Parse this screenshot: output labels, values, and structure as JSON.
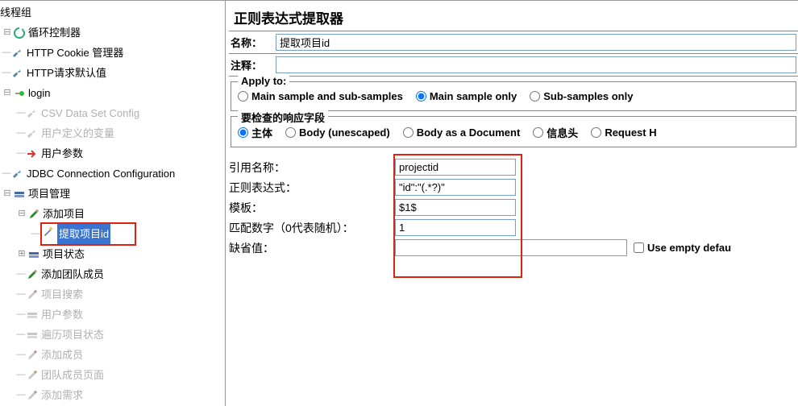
{
  "tree": {
    "root": "线程组",
    "items": [
      {
        "label": "循环控制器",
        "icon": "loop",
        "indent": 1,
        "toggle": "minus"
      },
      {
        "label": "HTTP Cookie 管理器",
        "icon": "wrench",
        "indent": 1,
        "dash": true
      },
      {
        "label": "HTTP请求默认值",
        "icon": "wrench",
        "indent": 1,
        "dash": true
      },
      {
        "label": "login",
        "icon": "dot-green",
        "indent": 1,
        "toggle": "minus"
      },
      {
        "label": "CSV Data Set Config",
        "icon": "wrench",
        "indent": 2,
        "dim": true,
        "dash": true
      },
      {
        "label": "用户定义的变量",
        "icon": "wrench",
        "indent": 2,
        "dim": true,
        "dash": true
      },
      {
        "label": "用户参数",
        "icon": "arrow-red",
        "indent": 2,
        "dash": true
      },
      {
        "label": "JDBC Connection Configuration",
        "icon": "wrench",
        "indent": 1,
        "dash": true
      },
      {
        "label": "项目管理",
        "icon": "stack",
        "indent": 1,
        "toggle": "minus"
      },
      {
        "label": "添加项目",
        "icon": "pencil",
        "indent": 2,
        "toggle": "minus"
      },
      {
        "label": "提取项目id",
        "icon": "wand",
        "indent": 3,
        "selected": true,
        "dash": true,
        "boxed": true
      },
      {
        "label": "项目状态",
        "icon": "stack",
        "indent": 2,
        "toggle": "plus"
      },
      {
        "label": "添加团队成员",
        "icon": "pencil",
        "indent": 2,
        "dash": true
      },
      {
        "label": "项目搜索",
        "icon": "pencil",
        "indent": 2,
        "dim": true,
        "dash": true
      },
      {
        "label": "用户参数",
        "icon": "stack",
        "indent": 2,
        "dim": true,
        "dash": true
      },
      {
        "label": "遍历项目状态",
        "icon": "stack",
        "indent": 2,
        "dim": true,
        "dash": true
      },
      {
        "label": "添加成员",
        "icon": "pencil",
        "indent": 2,
        "dim": true,
        "dash": true
      },
      {
        "label": "团队成员页面",
        "icon": "pencil",
        "indent": 2,
        "dim": true,
        "dash": true
      },
      {
        "label": "添加需求",
        "icon": "pencil",
        "indent": 2,
        "dim": true,
        "dash": true
      }
    ]
  },
  "panel": {
    "title": "正则表达式提取器",
    "name_label": "名称：",
    "name_value": "提取项目id",
    "comment_label": "注释：",
    "comment_value": "",
    "apply_group": "Apply to:",
    "apply_options": [
      "Main sample and sub-samples",
      "Main sample only",
      "Sub-samples only"
    ],
    "apply_selected": 1,
    "field_group": "要检查的响应字段",
    "field_options": [
      "主体",
      "Body (unescaped)",
      "Body as a Document",
      "信息头",
      "Request H"
    ],
    "field_selected": 0,
    "rows": {
      "ref_name_label": "引用名称：",
      "ref_name_value": "projectid",
      "regex_label": "正则表达式：",
      "regex_value": "\"id\":\"(.*?)\"",
      "template_label": "模板：",
      "template_value": "$1$",
      "match_label": "匹配数字（0代表随机）：",
      "match_value": "1",
      "default_label": "缺省值：",
      "default_value": ""
    },
    "empty_chk": "Use empty defau"
  }
}
